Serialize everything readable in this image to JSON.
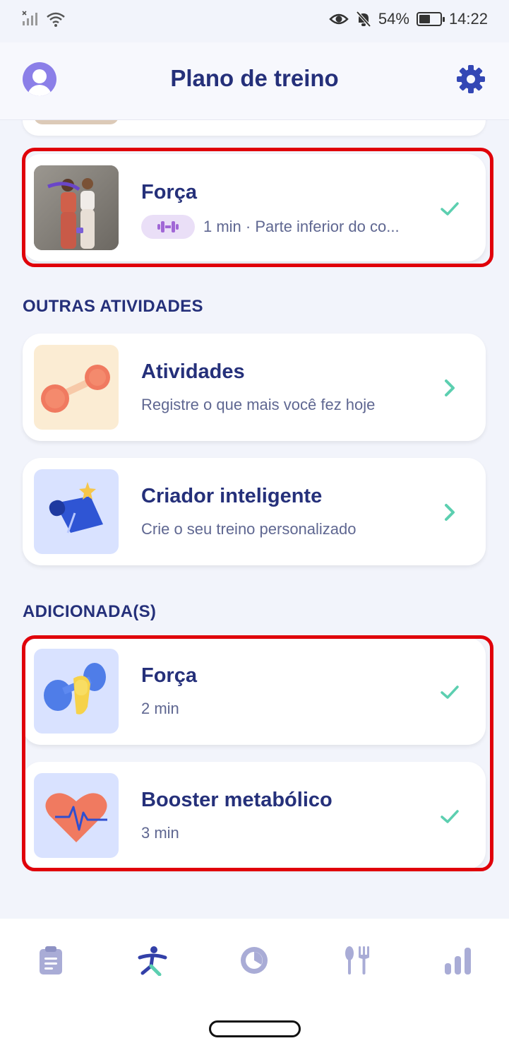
{
  "status_bar": {
    "battery_percent": "54%",
    "battery_level": 0.54,
    "time": "14:22"
  },
  "header": {
    "title": "Plano de treino",
    "avatar_icon": "user-avatar-icon",
    "settings_icon": "gear-icon"
  },
  "plan": {
    "force_card": {
      "title": "Força",
      "subtitle": "1 min · Parte inferior do co...",
      "badge_icon": "dumbbell-icon",
      "status": "completed"
    }
  },
  "other_activities": {
    "section_title": "OUTRAS ATIVIDADES",
    "items": [
      {
        "title": "Atividades",
        "subtitle": "Registre o que mais você fez hoje",
        "icon": "dumbbell-illustration"
      },
      {
        "title": "Criador inteligente",
        "subtitle": "Crie o seu treino personalizado",
        "icon": "yoga-mat-star-illustration"
      }
    ]
  },
  "added": {
    "section_title": "ADICIONADA(S)",
    "items": [
      {
        "title": "Força",
        "subtitle": "2 min",
        "icon": "hand-dumbbell-illustration",
        "status": "completed"
      },
      {
        "title": "Booster metabólico",
        "subtitle": "3 min",
        "icon": "heart-pulse-illustration",
        "status": "completed"
      }
    ]
  },
  "bottom_nav": {
    "items": [
      {
        "icon": "clipboard-icon",
        "active": false
      },
      {
        "icon": "running-person-icon",
        "active": true
      },
      {
        "icon": "fasting-timer-icon",
        "active": false
      },
      {
        "icon": "fork-knife-icon",
        "active": false
      },
      {
        "icon": "bar-chart-icon",
        "active": false
      }
    ]
  },
  "colors": {
    "primary_text": "#25307a",
    "secondary_text": "#5f6791",
    "accent_teal": "#5ccfb0",
    "highlight_red": "#e0000a",
    "nav_inactive": "#a9acd6",
    "nav_active": "#3340a8"
  }
}
